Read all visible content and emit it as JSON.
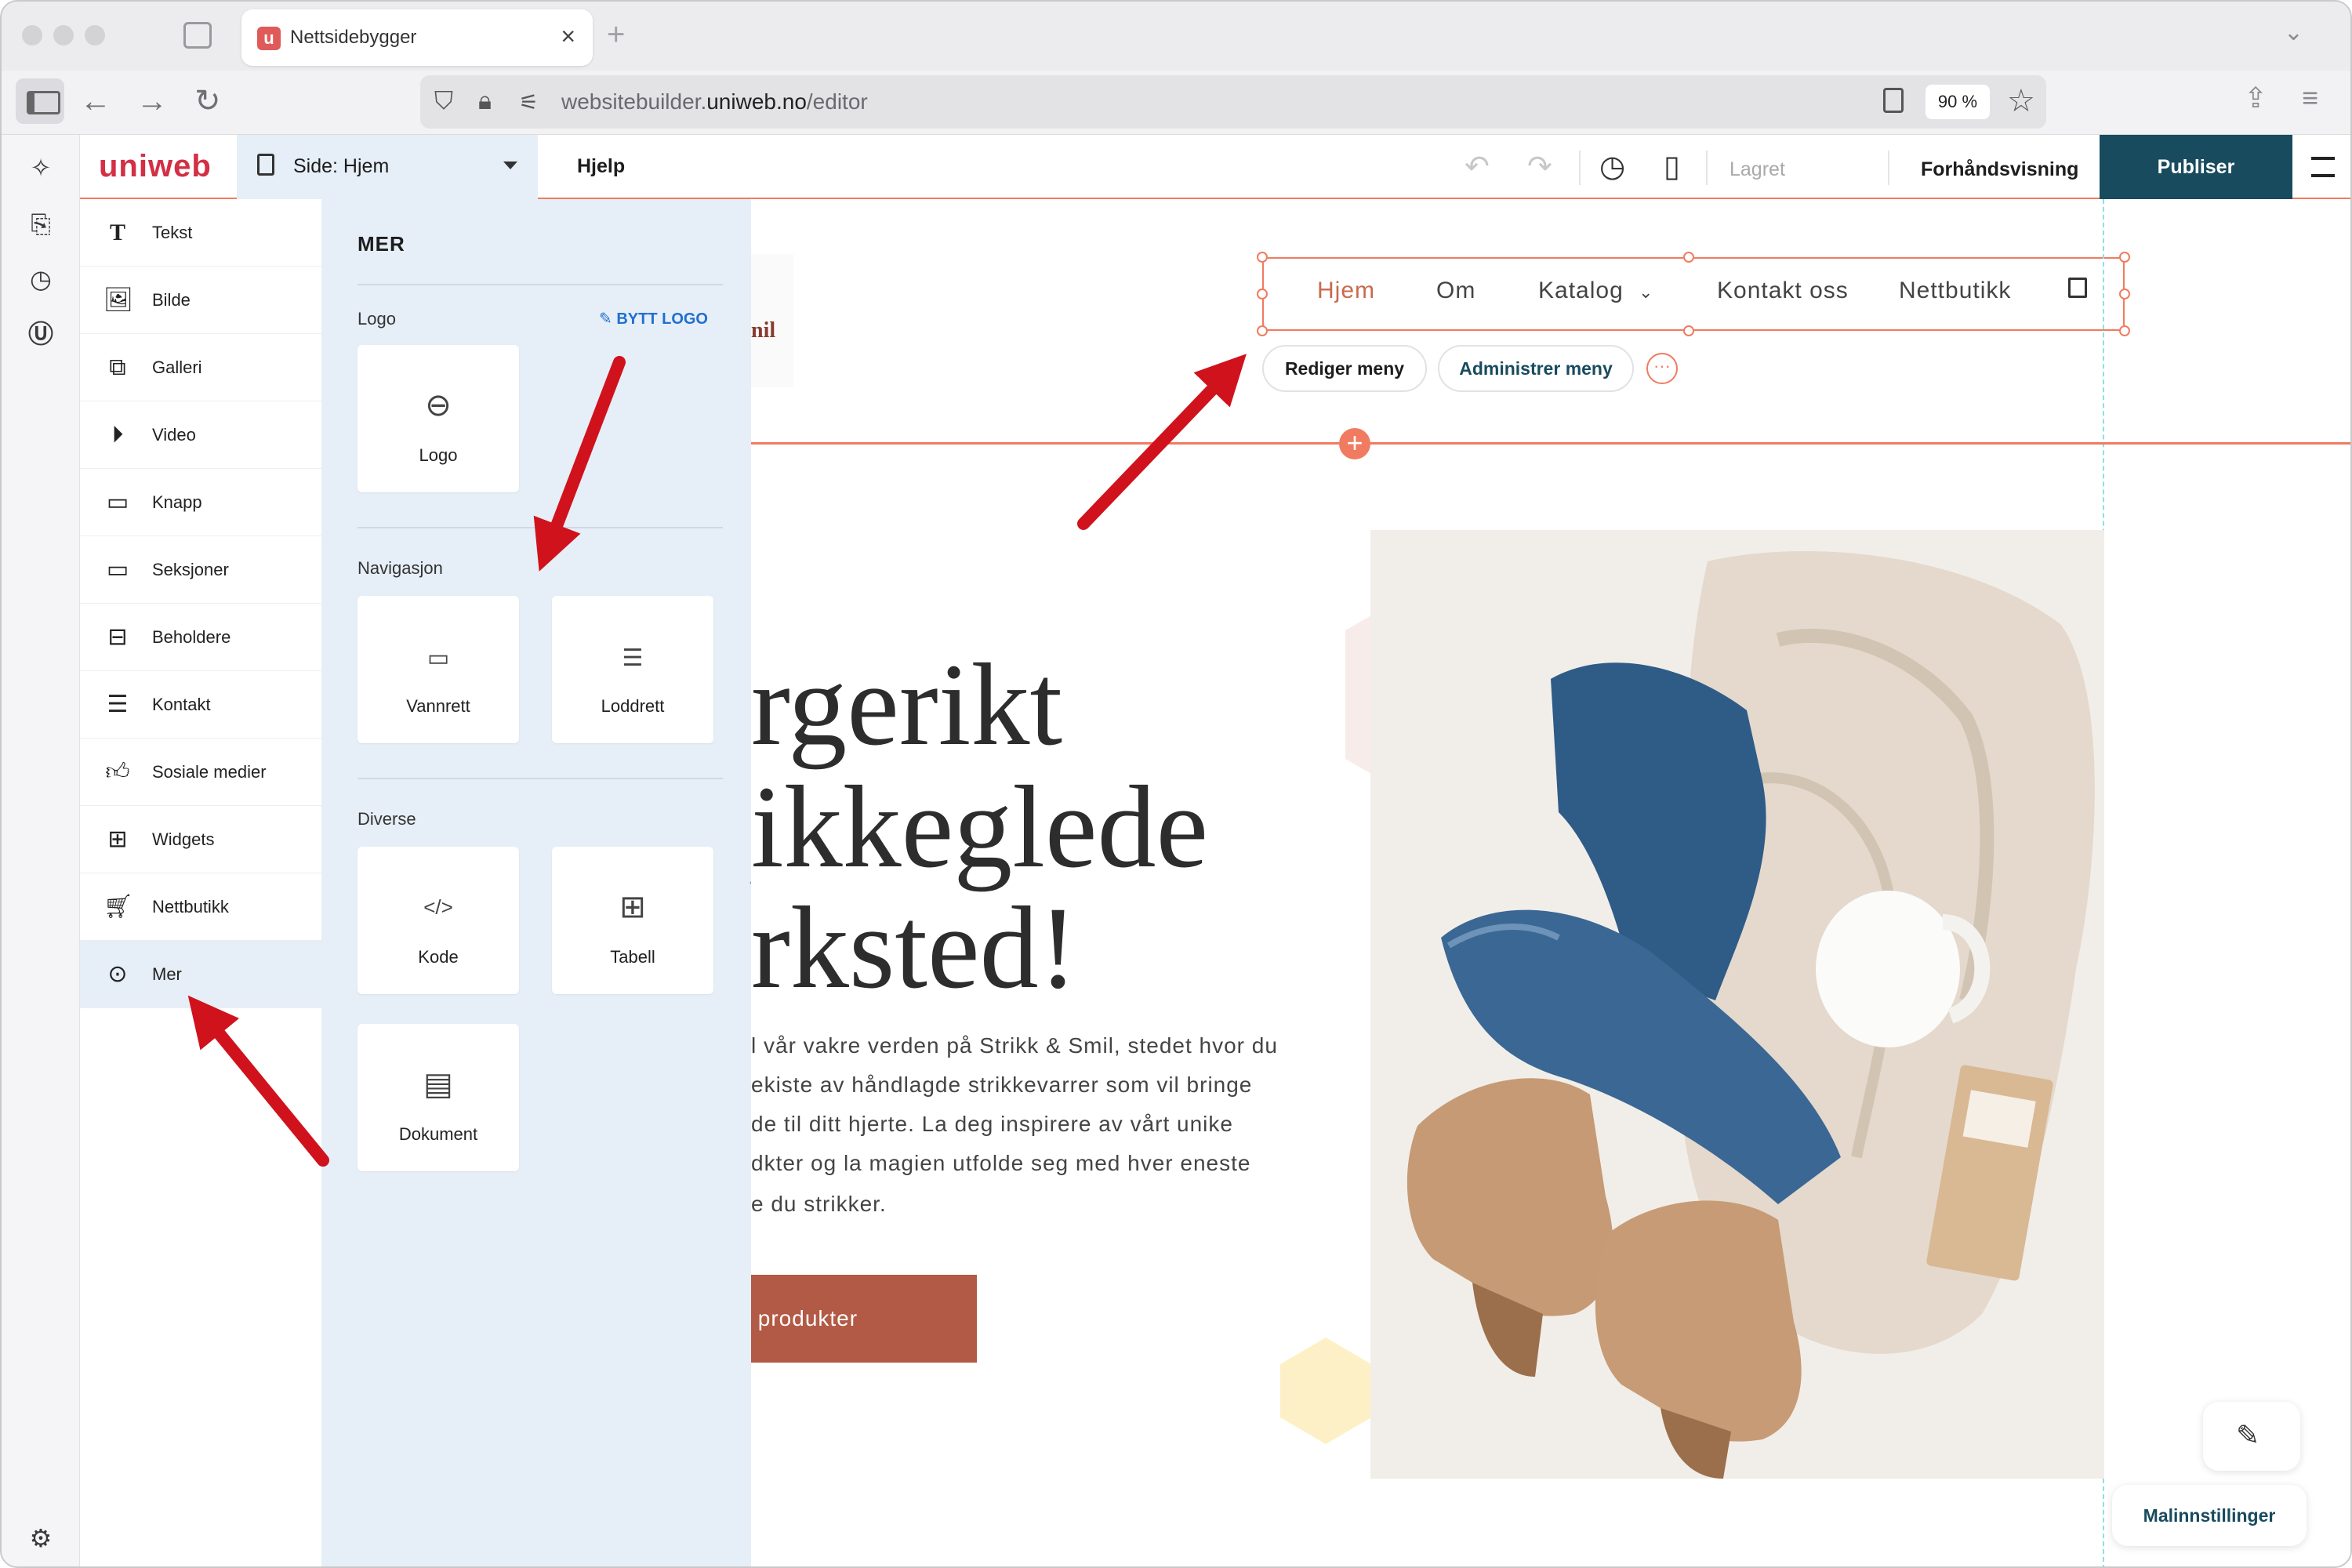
{
  "browser": {
    "tab_title": "Nettsidebygger",
    "tab_favicon": "u",
    "url_host": "websitebuilder.",
    "url_domain": "uniweb.no",
    "url_path": "/editor",
    "zoom": "90 %"
  },
  "editor": {
    "brand": "uniweb",
    "page_select": "Side: Hjem",
    "help": "Hjelp",
    "saved": "Lagret",
    "preview": "Forhåndsvisning",
    "publish": "Publiser"
  },
  "elements": [
    {
      "label": "Tekst",
      "icon": "text-icon"
    },
    {
      "label": "Bilde",
      "icon": "image-icon"
    },
    {
      "label": "Galleri",
      "icon": "gallery-icon"
    },
    {
      "label": "Video",
      "icon": "video-icon"
    },
    {
      "label": "Knapp",
      "icon": "button-icon"
    },
    {
      "label": "Seksjoner",
      "icon": "section-icon"
    },
    {
      "label": "Beholdere",
      "icon": "container-icon"
    },
    {
      "label": "Kontakt",
      "icon": "contact-icon"
    },
    {
      "label": "Sosiale medier",
      "icon": "thumbs-up-icon"
    },
    {
      "label": "Widgets",
      "icon": "widgets-icon"
    },
    {
      "label": "Nettbutikk",
      "icon": "cart-icon"
    },
    {
      "label": "Mer",
      "icon": "more-icon"
    }
  ],
  "mer": {
    "title": "MER",
    "logo_section": "Logo",
    "swap_logo": "BYTT LOGO",
    "logo_tile": "Logo",
    "nav_section": "Navigasjon",
    "horizontal": "Vannrett",
    "vertical": "Loddrett",
    "misc_section": "Diverse",
    "code": "Kode",
    "table": "Tabell",
    "document": "Dokument"
  },
  "site": {
    "logo_fragment": "nil",
    "nav": [
      "Hjem",
      "Om",
      "Katalog",
      "Kontakt oss",
      "Nettbutikk"
    ],
    "edit_menu": "Rediger meny",
    "manage_menu": "Administrer meny",
    "hero_lines": [
      "rgerikt",
      "ikkeglede",
      "rksted!"
    ],
    "hero_paragraph": [
      "l vår vakre verden på Strikk & Smil, stedet hvor du",
      "ekiste av håndlagde strikkevarrer som vil bringe",
      "de til ditt hjerte. La deg inspirere av vårt unike",
      "dkter og la magien utfolde seg med hver eneste",
      "e du strikker."
    ],
    "cta": "produkter",
    "template_settings": "Malinnstillinger"
  },
  "colors": {
    "accent": "#f07b60",
    "brand_red": "#d32f45",
    "publish_bg": "#184b5e",
    "cta_bg": "#b25a45",
    "panel_bg": "#e6eef7",
    "arrow": "#d0121c"
  }
}
